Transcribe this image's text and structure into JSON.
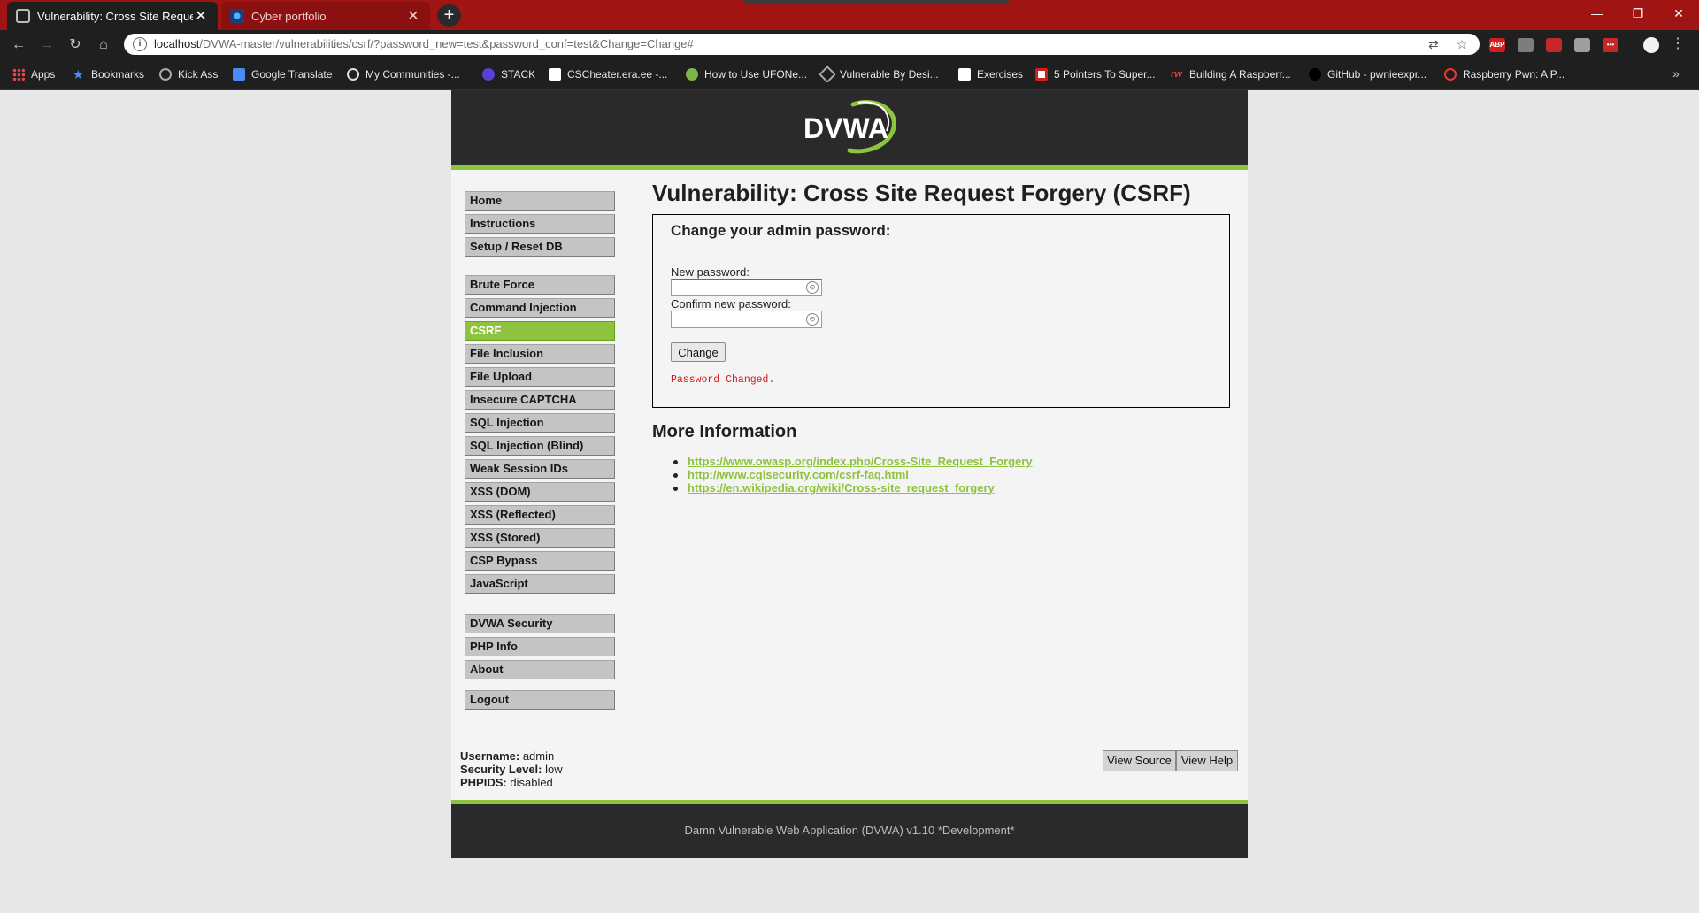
{
  "browser": {
    "tabs": [
      {
        "title": "Vulnerability: Cross Site Request",
        "close": "✕"
      },
      {
        "title": "Cyber portfolio",
        "close": "✕"
      }
    ],
    "new_tab": "+",
    "window_controls": {
      "minimize": "—",
      "maximize": "❐",
      "close": "✕"
    },
    "nav": {
      "back": "←",
      "forward": "→",
      "reload": "↻",
      "home": "⌂"
    },
    "url_host": "localhost",
    "url_path": "/DVWA-master/vulnerabilities/csrf/?password_new=test&password_conf=test&Change=Change#",
    "extensions": [
      "ABP",
      "",
      "",
      "",
      "•••"
    ],
    "bookmarks": [
      {
        "label": "Apps",
        "icon": "apps-grid-icon"
      },
      {
        "label": "Bookmarks",
        "icon": "star-icon"
      },
      {
        "label": "Kick Ass",
        "icon": "globe-icon"
      },
      {
        "label": "Google Translate",
        "icon": "translate-icon"
      },
      {
        "label": "My Communities -...",
        "icon": "community-icon"
      },
      {
        "label": "STACK",
        "icon": "stack-icon"
      },
      {
        "label": "CSCheater.era.ee -...",
        "icon": "wix-icon"
      },
      {
        "label": "How to Use UFONe...",
        "icon": "ufo-icon"
      },
      {
        "label": "Vulnerable By Desi...",
        "icon": "vulnhub-icon"
      },
      {
        "label": "Exercises",
        "icon": "ha-icon"
      },
      {
        "label": "5 Pointers To Super...",
        "icon": "sw-icon"
      },
      {
        "label": "Building A Raspberr...",
        "icon": "rw-icon"
      },
      {
        "label": "GitHub - pwnieexpr...",
        "icon": "github-icon"
      },
      {
        "label": "Raspberry Pwn: A P...",
        "icon": "raspberry-icon"
      }
    ],
    "bookmarks_more": "»"
  },
  "dvwa": {
    "logo_text": "DVWA",
    "menu": {
      "group1": [
        "Home",
        "Instructions",
        "Setup / Reset DB"
      ],
      "group2": [
        "Brute Force",
        "Command Injection",
        "CSRF",
        "File Inclusion",
        "File Upload",
        "Insecure CAPTCHA",
        "SQL Injection",
        "SQL Injection (Blind)",
        "Weak Session IDs",
        "XSS (DOM)",
        "XSS (Reflected)",
        "XSS (Stored)",
        "CSP Bypass",
        "JavaScript"
      ],
      "group3": [
        "DVWA Security",
        "PHP Info",
        "About"
      ],
      "group4": [
        "Logout"
      ],
      "active": "CSRF"
    },
    "page_title": "Vulnerability: Cross Site Request Forgery (CSRF)",
    "form": {
      "heading": "Change your admin password:",
      "new_password_label": "New password:",
      "new_password_value": "",
      "confirm_password_label": "Confirm new password:",
      "confirm_password_value": "",
      "submit_label": "Change",
      "status": "Password Changed."
    },
    "more_info": {
      "heading": "More Information",
      "links": [
        "https://www.owasp.org/index.php/Cross-Site_Request_Forgery",
        "http://www.cgisecurity.com/csrf-faq.html",
        "https://en.wikipedia.org/wiki/Cross-site_request_forgery"
      ]
    },
    "user_info": {
      "username_label": "Username:",
      "username": "admin",
      "security_label": "Security Level:",
      "security": "low",
      "phpids_label": "PHPIDS:",
      "phpids": "disabled"
    },
    "buttons": {
      "view_source": "View Source",
      "view_help": "View Help"
    },
    "footer": "Damn Vulnerable Web Application (DVWA) v1.10 *Development*"
  },
  "colors": {
    "dvwa_green": "#8dc33d",
    "dvwa_dark": "#2a2a2a",
    "status_red": "#d21a1a",
    "tabstrip_red": "#a01414"
  }
}
